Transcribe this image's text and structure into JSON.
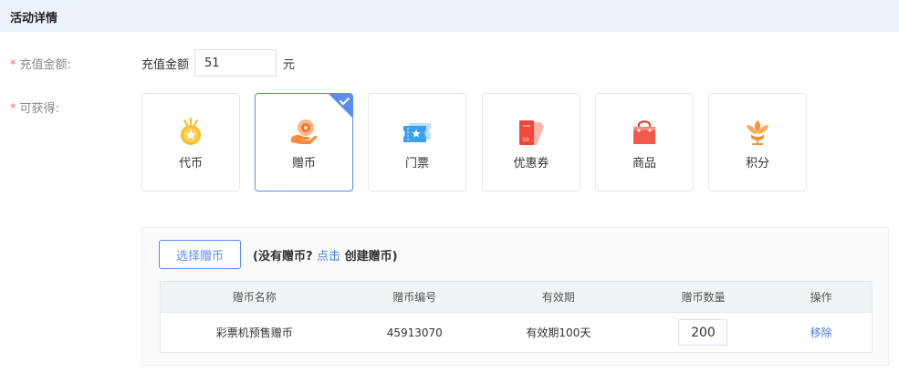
{
  "section": {
    "title": "活动详情"
  },
  "form": {
    "recharge_label": "充值金额:",
    "receive_label": "可获得:",
    "required_mark": "*"
  },
  "recharge": {
    "prefix": "充值金额",
    "value": "51",
    "suffix": "元"
  },
  "rewards": {
    "items": [
      {
        "label": "代币",
        "icon": "medal-icon",
        "selected": false
      },
      {
        "label": "赠币",
        "icon": "gift-coin-icon",
        "selected": true
      },
      {
        "label": "门票",
        "icon": "ticket-icon",
        "selected": false
      },
      {
        "label": "优惠券",
        "icon": "coupon-icon",
        "selected": false
      },
      {
        "label": "商品",
        "icon": "shopping-bag-icon",
        "selected": false
      },
      {
        "label": "积分",
        "icon": "flower-points-icon",
        "selected": false
      }
    ],
    "selected_index": 1
  },
  "panel": {
    "select_button": "选择赠币",
    "hint_open": "(没有赠币?",
    "hint_link": "点击",
    "hint_tail": "创建赠币)"
  },
  "table": {
    "headers": [
      "赠币名称",
      "赠币编号",
      "有效期",
      "赠币数量",
      "操作"
    ],
    "rows": [
      {
        "name": "彩票机预售赠币",
        "code": "45913070",
        "validity": "有效期100天",
        "quantity": "200",
        "action": "移除"
      }
    ]
  },
  "colors": {
    "accent": "#5b8def",
    "link": "#4a7fdb",
    "required": "#f56c6c",
    "header_bg": "#eef3fb"
  }
}
